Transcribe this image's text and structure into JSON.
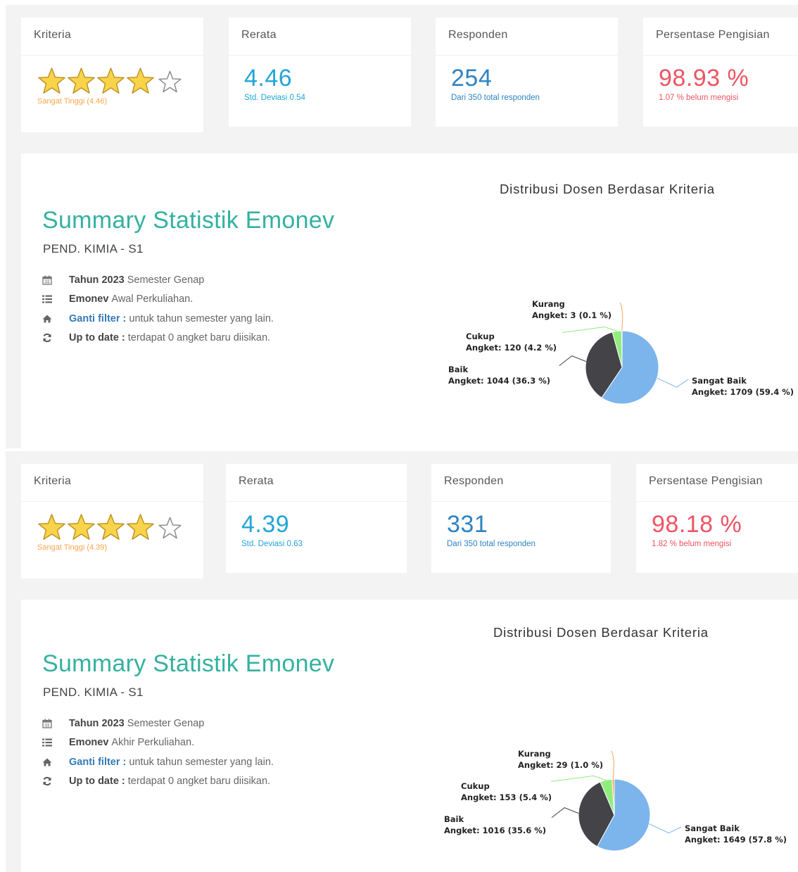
{
  "blocks": [
    {
      "kriteria": {
        "header": "Kriteria",
        "rating": 4.46,
        "label": "Sangat Tinggi (4.46)"
      },
      "rerata": {
        "header": "Rerata",
        "value": "4.46",
        "sub": "Std. Deviasi 0.54"
      },
      "responden": {
        "header": "Responden",
        "value": "254",
        "sub": "Dari 350 total responden"
      },
      "persentase": {
        "header": "Persentase Pengisian",
        "value": "98.93 %",
        "sub": "1.07 % belum mengisi"
      },
      "summary": {
        "title": "Summary Statistik Emonev",
        "subtitle": "PEND. KIMIA - S1",
        "tahun_bold": "Tahun 2023",
        "tahun_text": "Semester Genap",
        "emonev_bold": "Emonev",
        "emonev_text": "Awal Perkuliahan.",
        "filter_link": "Ganti filter :",
        "filter_text": "untuk tahun semester yang lain.",
        "update_bold": "Up to date :",
        "update_text": "terdapat 0 angket baru diisikan."
      },
      "chart_data": {
        "type": "pie",
        "title": "Distribusi Dosen Berdasar Kriteria",
        "slices": [
          {
            "name": "Sangat Baik",
            "label": "Angket: 1709 (59.4 %)",
            "value": 1709,
            "percent": 59.4,
            "color": "#7cb5ec"
          },
          {
            "name": "Baik",
            "label": "Angket: 1044 (36.3 %)",
            "value": 1044,
            "percent": 36.3,
            "color": "#434348"
          },
          {
            "name": "Cukup",
            "label": "Angket: 120 (4.2 %)",
            "value": 120,
            "percent": 4.2,
            "color": "#90ed7d"
          },
          {
            "name": "Kurang",
            "label": "Angket: 3 (0.1 %)",
            "value": 3,
            "percent": 0.1,
            "color": "#f7a35c"
          }
        ]
      }
    },
    {
      "kriteria": {
        "header": "Kriteria",
        "rating": 4.39,
        "label": "Sangat Tinggi (4.39)"
      },
      "rerata": {
        "header": "Rerata",
        "value": "4.39",
        "sub": "Std. Deviasi 0.63"
      },
      "responden": {
        "header": "Responden",
        "value": "331",
        "sub": "Dari 350 total responden"
      },
      "persentase": {
        "header": "Persentase Pengisian",
        "value": "98.18 %",
        "sub": "1.82 % belum mengisi"
      },
      "summary": {
        "title": "Summary Statistik Emonev",
        "subtitle": "PEND. KIMIA - S1",
        "tahun_bold": "Tahun 2023",
        "tahun_text": "Semester Genap",
        "emonev_bold": "Emonev",
        "emonev_text": "Akhir Perkuliahan.",
        "filter_link": "Ganti filter :",
        "filter_text": "untuk tahun semester yang lain.",
        "update_bold": "Up to date :",
        "update_text": "terdapat 0 angket baru diisikan."
      },
      "chart_data": {
        "type": "pie",
        "title": "Distribusi Dosen Berdasar Kriteria",
        "slices": [
          {
            "name": "Sangat Baik",
            "label": "Angket: 1649 (57.8 %)",
            "value": 1649,
            "percent": 57.8,
            "color": "#7cb5ec"
          },
          {
            "name": "Baik",
            "label": "Angket: 1016 (35.6 %)",
            "value": 1016,
            "percent": 35.6,
            "color": "#434348"
          },
          {
            "name": "Cukup",
            "label": "Angket: 153 (5.4 %)",
            "value": 153,
            "percent": 5.4,
            "color": "#90ed7d"
          },
          {
            "name": "Kurang",
            "label": "Angket: 29 (1.0 %)",
            "value": 29,
            "percent": 1.0,
            "color": "#f7a35c"
          }
        ]
      }
    }
  ]
}
